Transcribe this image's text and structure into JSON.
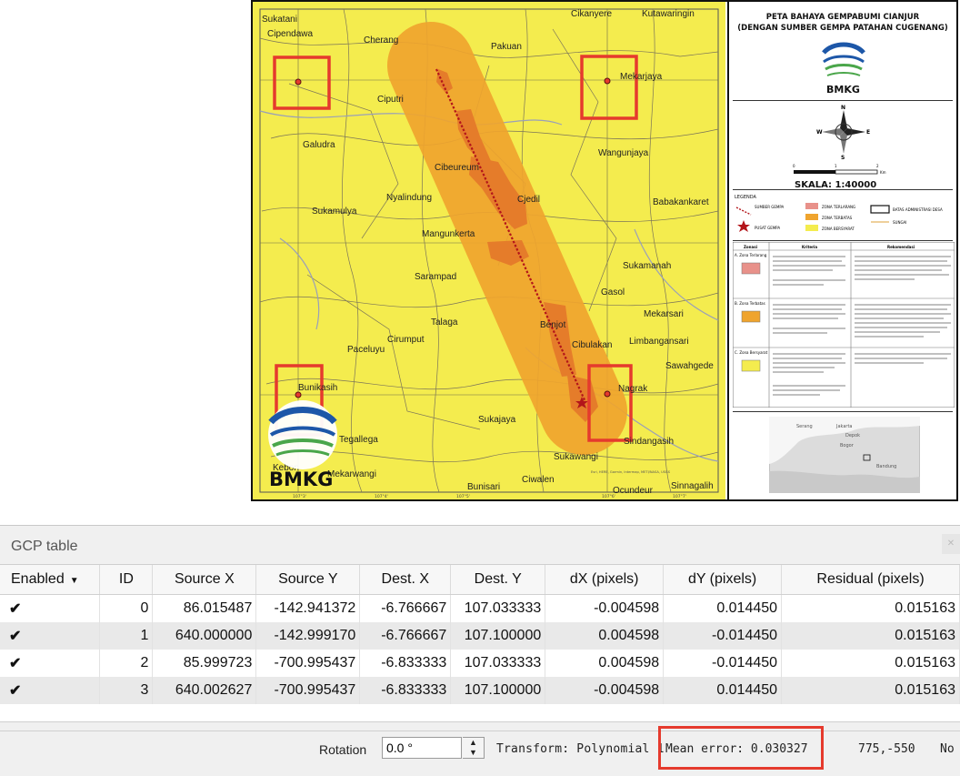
{
  "map": {
    "labels": {
      "sukatani": "Sukatani",
      "cipendawa": "Cipendawa",
      "cherang": "Cherang",
      "cikanyere": "Cikanyere",
      "kutawaringin": "Kutawaringin",
      "pakuan": "Pakuan",
      "mekarjaya": "Mekarjaya",
      "ciputri": "Ciputri",
      "galudra": "Galudra",
      "wangunjaya": "Wangunjaya",
      "cibeureum": "Cibeureum",
      "nyalindung": "Nyalindung",
      "cjedil": "Cjedil",
      "sukamulya": "Sukamulya",
      "babakankaret": "Babakankaret",
      "mangunkerta": "Mangunkerta",
      "sukamanah": "Sukamanah",
      "sarampad": "Sarampad",
      "gasol": "Gasol",
      "mekarsari": "Mekarsari",
      "talaga": "Talaga",
      "benjot": "Benjot",
      "cirumput": "Cirumput",
      "limbangansari": "Limbangansari",
      "cibulakan": "Cibulakan",
      "paceluyu": "Paceluyu",
      "sawahgede": "Sawahgede",
      "bunikasih": "Bunikasih",
      "nagrak": "Nagrak",
      "sukajaya": "Sukajaya",
      "tegallega": "Tegallega",
      "sindangasih": "Sindangasih",
      "kebon": "Kebon",
      "mekarwangi": "Mekarwangi",
      "sukawangi": "Sukawangi",
      "bunisari": "Bunisari",
      "ciwalen": "Ciwalen",
      "ocundeur": "Ocundeur",
      "sinnagalih": "Sinnagalih",
      "esri": "Esri, HERE, Garmin, Intermap, METI/NASA, USGS",
      "tick1": "107°3'",
      "tick2": "107°4'",
      "tick3": "107°5'",
      "tick4": "107°6'",
      "tick5": "107°7'"
    },
    "bmkg": "BMKG"
  },
  "panel": {
    "title_line1": "PETA BAHAYA GEMPABUMI CIANJUR",
    "title_line2": "(DENGAN SUMBER GEMPA PATAHAN CUGENANG)",
    "logo_text": "BMKG",
    "compass": {
      "n": "N",
      "s": "S",
      "e": "E",
      "w": "W"
    },
    "scale_ticks": [
      "0",
      "1",
      "2"
    ],
    "scale_unit": "Km",
    "scale_label": "SKALA: 1:40000",
    "legend_title": "LEGENDA",
    "legend_items": {
      "fault": "SUMBER GEMPA",
      "epicenter": "PUSAT GEMPA",
      "zone_high": "ZONA TERLARANG",
      "zone_mid": "ZONA TERBATAS",
      "zone_low": "ZONA BERSYARAT",
      "boundary": "BATAS ADMINISTRASI DESA",
      "river": "SUNGAI"
    },
    "zone_table_headers": [
      "Zonasi",
      "Kriteria",
      "Rekomendasi"
    ],
    "zone_rows": [
      "A. Zona Terlarang",
      "B. Zona Terbatas",
      "C. Zona Bersyarat"
    ],
    "inset": {
      "serang": "Serang",
      "jakarta": "Jakarta",
      "depok": "Depok",
      "bogor": "Bogor",
      "bandung": "Bandung"
    }
  },
  "colors": {
    "map_yellow": "#f4ec4e",
    "buffer_orange": "#efa42e",
    "zone_dark_orange": "#e57c2a",
    "fault_line": "#b3151a",
    "highlight_red": "#e53a2d"
  },
  "gcp": {
    "title": "GCP table",
    "headers": [
      "Enabled",
      "ID",
      "Source X",
      "Source Y",
      "Dest. X",
      "Dest. Y",
      "dX (pixels)",
      "dY (pixels)",
      "Residual (pixels)"
    ],
    "rows": [
      {
        "enabled": "✔",
        "id": "0",
        "sx": "86.015487",
        "sy": "-142.941372",
        "dx_": "-6.766667",
        "dy_": "107.033333",
        "dxp": "-0.004598",
        "dyp": "0.014450",
        "res": "0.015163"
      },
      {
        "enabled": "✔",
        "id": "1",
        "sx": "640.000000",
        "sy": "-142.999170",
        "dx_": "-6.766667",
        "dy_": "107.100000",
        "dxp": "0.004598",
        "dyp": "-0.014450",
        "res": "0.015163"
      },
      {
        "enabled": "✔",
        "id": "2",
        "sx": "85.999723",
        "sy": "-700.995437",
        "dx_": "-6.833333",
        "dy_": "107.033333",
        "dxp": "0.004598",
        "dyp": "-0.014450",
        "res": "0.015163"
      },
      {
        "enabled": "✔",
        "id": "3",
        "sx": "640.002627",
        "sy": "-700.995437",
        "dx_": "-6.833333",
        "dy_": "107.100000",
        "dxp": "-0.004598",
        "dyp": "0.014450",
        "res": "0.015163"
      }
    ],
    "status": {
      "rotation_label": "Rotation",
      "rotation_value": "0.0 °",
      "transform": "Transform: Polynomial 1",
      "mean_error": "Mean error: 0.030327",
      "coords": "775,-550",
      "trailing": "No"
    }
  }
}
